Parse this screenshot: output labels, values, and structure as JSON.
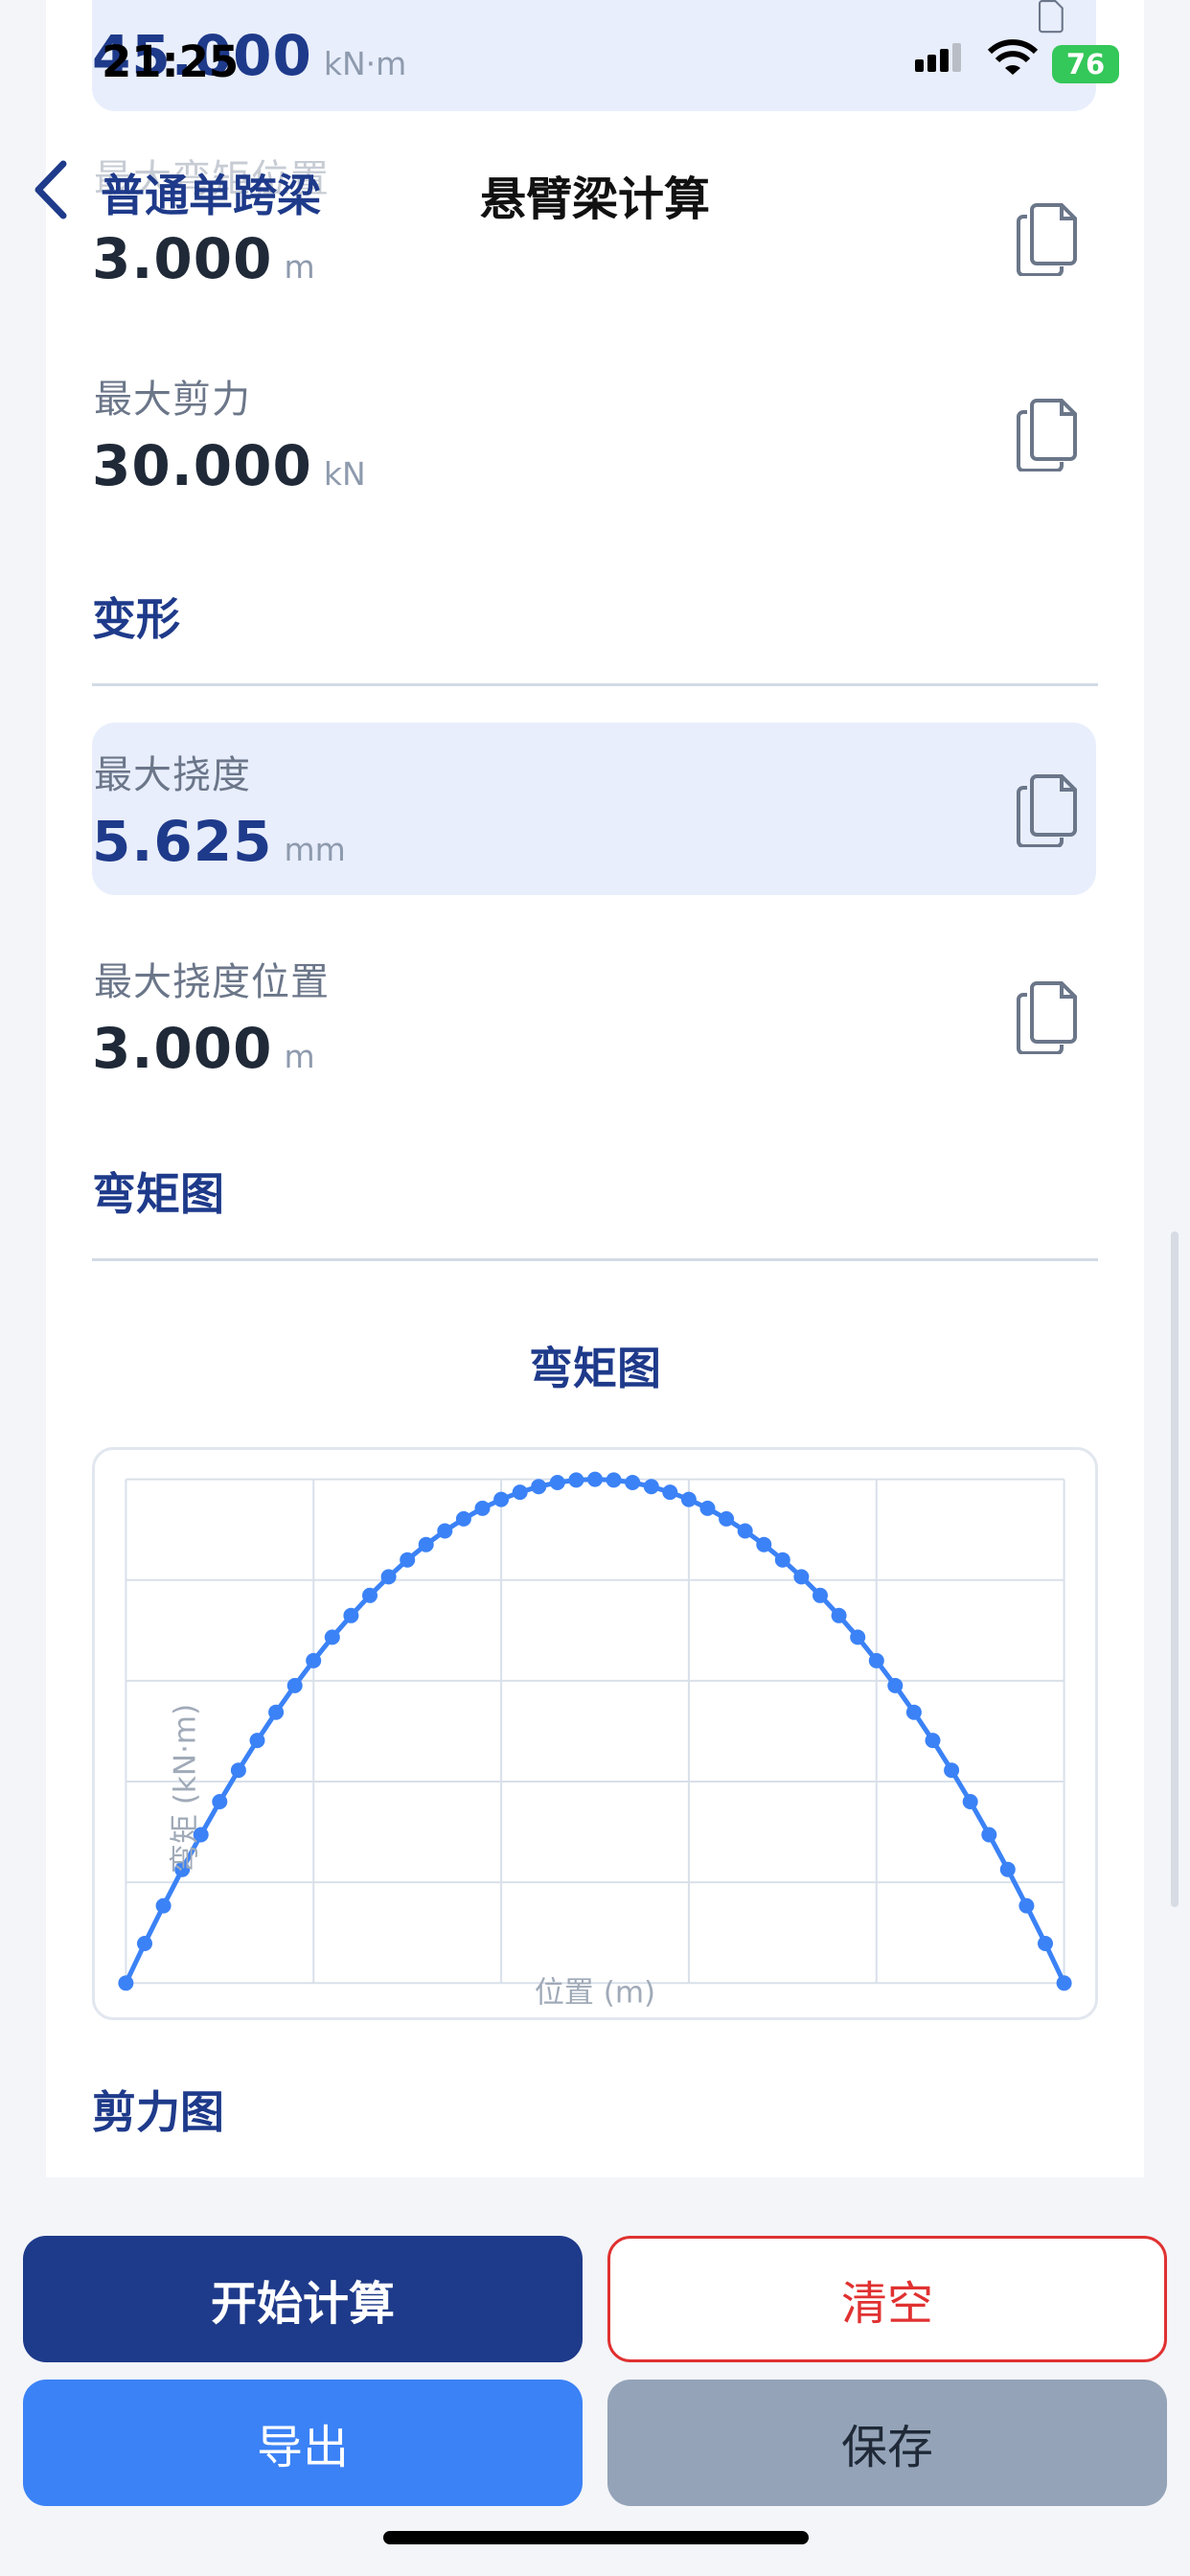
{
  "status_bar": {
    "time": "21:25",
    "battery": "76"
  },
  "nav": {
    "back_label": "普通单跨梁",
    "title": "悬臂梁计算"
  },
  "results": {
    "top_value": "45.000",
    "top_unit": "kN·m",
    "max_moment_pos": {
      "label": "最大弯矩位置",
      "value": "3.000",
      "unit": "m"
    },
    "max_shear": {
      "label": "最大剪力",
      "value": "30.000",
      "unit": "kN"
    }
  },
  "deformation": {
    "section": "变形",
    "max_deflection": {
      "label": "最大挠度",
      "value": "5.625",
      "unit": "mm"
    },
    "max_deflection_pos": {
      "label": "最大挠度位置",
      "value": "3.000",
      "unit": "m"
    }
  },
  "moment_diagram": {
    "section": "弯矩图",
    "chart_title": "弯矩图"
  },
  "shear_diagram": {
    "section": "剪力图"
  },
  "chart_data": {
    "type": "line",
    "title": "弯矩图",
    "xlabel": "位置 (m)",
    "ylabel": "弯矩 (kN·m)",
    "xlim": [
      0,
      6
    ],
    "ylim": [
      0,
      45
    ],
    "grid": true,
    "color": "#3b82f6",
    "x": [
      0,
      0.12,
      0.24,
      0.36,
      0.48,
      0.6,
      0.72,
      0.84,
      0.96,
      1.08,
      1.2,
      1.32,
      1.44,
      1.56,
      1.68,
      1.8,
      1.92,
      2.04,
      2.16,
      2.28,
      2.4,
      2.52,
      2.64,
      2.76,
      2.88,
      3.0,
      3.12,
      3.24,
      3.36,
      3.48,
      3.6,
      3.72,
      3.84,
      3.96,
      4.08,
      4.2,
      4.32,
      4.44,
      4.56,
      4.68,
      4.8,
      4.92,
      5.04,
      5.16,
      5.28,
      5.4,
      5.52,
      5.64,
      5.76,
      5.88,
      6.0
    ],
    "y": [
      0,
      3.53,
      6.91,
      10.15,
      13.25,
      16.2,
      19.01,
      21.67,
      24.19,
      26.57,
      28.8,
      30.89,
      32.83,
      34.63,
      36.29,
      37.8,
      39.17,
      40.39,
      41.47,
      42.41,
      43.2,
      43.85,
      44.35,
      44.71,
      44.93,
      45.0,
      44.93,
      44.71,
      44.35,
      43.85,
      43.2,
      42.41,
      41.47,
      40.39,
      39.17,
      37.8,
      36.29,
      34.63,
      32.83,
      30.89,
      28.8,
      26.57,
      24.19,
      21.67,
      19.01,
      16.2,
      13.25,
      10.15,
      6.91,
      3.53,
      0
    ]
  },
  "actions": {
    "calculate": "开始计算",
    "clear": "清空",
    "export": "导出",
    "save": "保存"
  },
  "colors": {
    "primary": "#1e3a8a",
    "accent": "#3b82f6",
    "danger": "#e03131",
    "highlight": "#e8eefc"
  }
}
